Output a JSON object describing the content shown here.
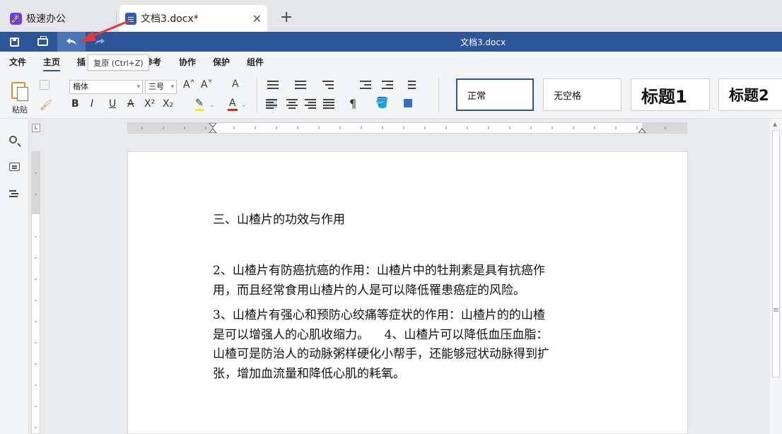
{
  "tabs": [
    {
      "label": "极速办公"
    },
    {
      "label": "文档3.docx*"
    }
  ],
  "tab_add": "+",
  "tab_close": "✕",
  "quickbar": {
    "title": "文档3.docx"
  },
  "tooltip": "复原 (Ctrl+Z)",
  "menu": [
    "文件",
    "主页",
    "插",
    "参考",
    "协作",
    "保护",
    "组件"
  ],
  "ribbon": {
    "paste_label": "粘贴",
    "font_name": "楷体",
    "font_size": "三号",
    "grow_font": "A˄",
    "shrink_font": "A˅",
    "clear_format": "A",
    "bold": "B",
    "italic": "I",
    "underline": "U",
    "strike": "A",
    "superscript": "X²",
    "subscript": "X₂",
    "highlight_glyph": "✎",
    "font_color_glyph": "A",
    "pilcrow": "¶",
    "styles": [
      "正常",
      "无空格",
      "标题1",
      "标题2"
    ]
  },
  "ruler": {
    "corner": "L"
  },
  "document": {
    "heading": "三、山楂片的功效与作用",
    "paragraphs": [
      [
        "2、山楂片有防癌抗癌的作用：山楂片中的牡荆素是具有抗癌作",
        "用，而且经常食用山楂片的人是可以降低罹患癌症的风险。"
      ],
      [
        "3、山楂片有强心和预防心绞痛等症状的作用：山楂片的的山楂",
        "是可以增强人的心肌收缩力。    4、山楂片可以降低血压血脂：",
        "山楂可是防治人的动脉粥样硬化小帮手，还能够冠状动脉得到扩",
        "张，增加血流量和降低心肌的耗氧。"
      ]
    ]
  },
  "colors": {
    "accent": "#2b579a",
    "annotation": "#e53935",
    "highlight": "#f5e90a",
    "font_color": "#d7261e"
  }
}
